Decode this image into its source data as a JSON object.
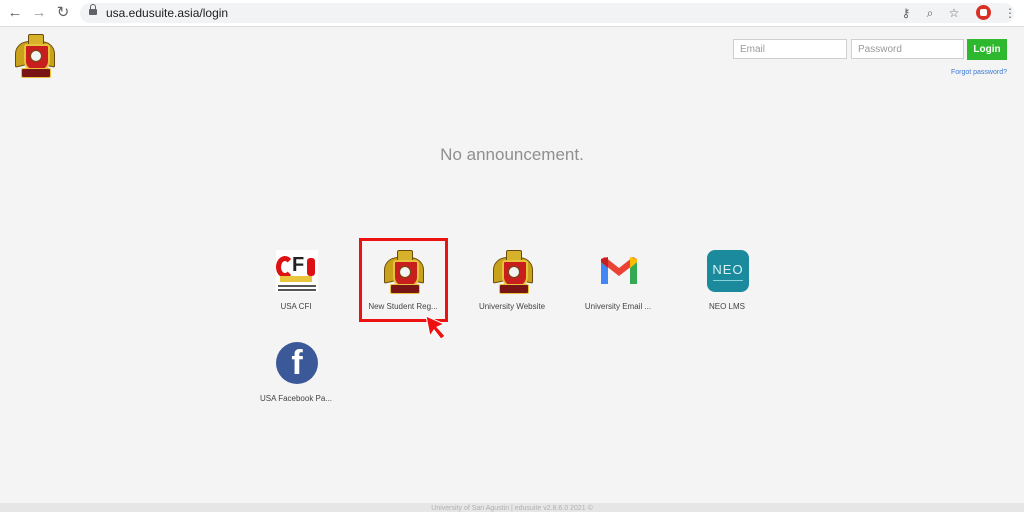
{
  "browser": {
    "url": "usa.edusuite.asia/login"
  },
  "header": {
    "email_placeholder": "Email",
    "password_placeholder": "Password",
    "login_label": "Login",
    "forgot_label": "Forgot password?"
  },
  "main": {
    "announcement": "No announcement."
  },
  "apps": [
    {
      "label": "USA CFI",
      "icon": "cfi-logo-icon"
    },
    {
      "label": "New Student Reg...",
      "icon": "university-crest-icon"
    },
    {
      "label": "University Website",
      "icon": "university-crest-icon"
    },
    {
      "label": "University Email ...",
      "icon": "gmail-icon"
    },
    {
      "label": "NEO LMS",
      "icon": "neo-lms-icon",
      "icon_text": "NEO"
    },
    {
      "label": "USA Facebook Pa...",
      "icon": "facebook-icon"
    }
  ],
  "footer": {
    "text": "University of San Agustin | edusuite v2.8.6.0 2021 ©"
  },
  "colors": {
    "login_button": "#2db82d",
    "link": "#3a7bd5",
    "highlight": "#ee1111",
    "neo": "#1a8a9c",
    "facebook": "#3b5998"
  }
}
